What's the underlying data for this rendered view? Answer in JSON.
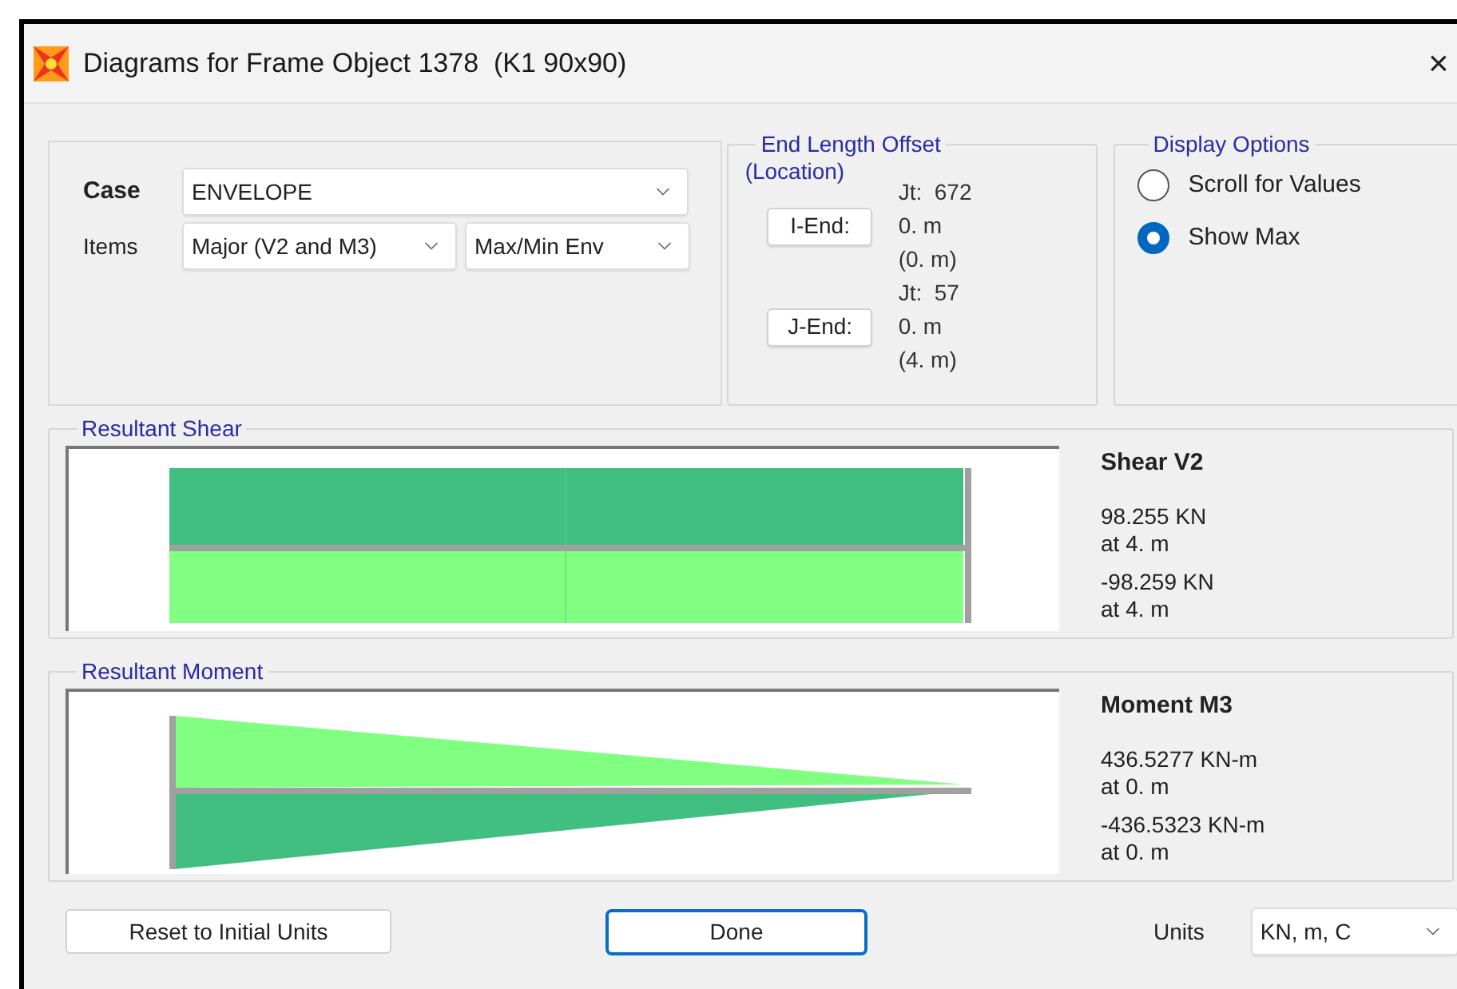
{
  "window": {
    "title": "Diagrams for Frame Object 1378  (K1 90x90)",
    "close": "×"
  },
  "case": {
    "label": "Case",
    "value": "ENVELOPE"
  },
  "items": {
    "label": "Items",
    "component": "Major (V2 and M3)",
    "type": "Max/Min Env"
  },
  "end_offset": {
    "title": "End Length Offset",
    "subtitle": "(Location)",
    "ends": [
      {
        "button": "I-End:",
        "joint": "Jt:  672",
        "offset": "0. m",
        "location": "(0. m)"
      },
      {
        "button": "J-End:",
        "joint": "Jt:  57",
        "offset": "0. m",
        "location": "(4. m)"
      }
    ]
  },
  "display_options": {
    "title": "Display Options",
    "options": [
      {
        "label": "Scroll for Values",
        "selected": false
      },
      {
        "label": "Show Max",
        "selected": true
      }
    ]
  },
  "diagrams": [
    {
      "kind": "shear",
      "title": "Resultant Shear",
      "heading": "Shear V2",
      "max_value": "98.255 KN",
      "max_at": "at 4. m",
      "min_value": "-98.259 KN",
      "min_at": "at 4. m"
    },
    {
      "kind": "moment",
      "title": "Resultant Moment",
      "heading": "Moment M3",
      "max_value": "436.5277 KN-m",
      "max_at": "at 0. m",
      "min_value": "-436.5323 KN-m",
      "min_at": "at 0. m"
    }
  ],
  "buttons": {
    "reset": "Reset to Initial Units",
    "done": "Done"
  },
  "units": {
    "label": "Units",
    "value": "KN, m, C"
  }
}
